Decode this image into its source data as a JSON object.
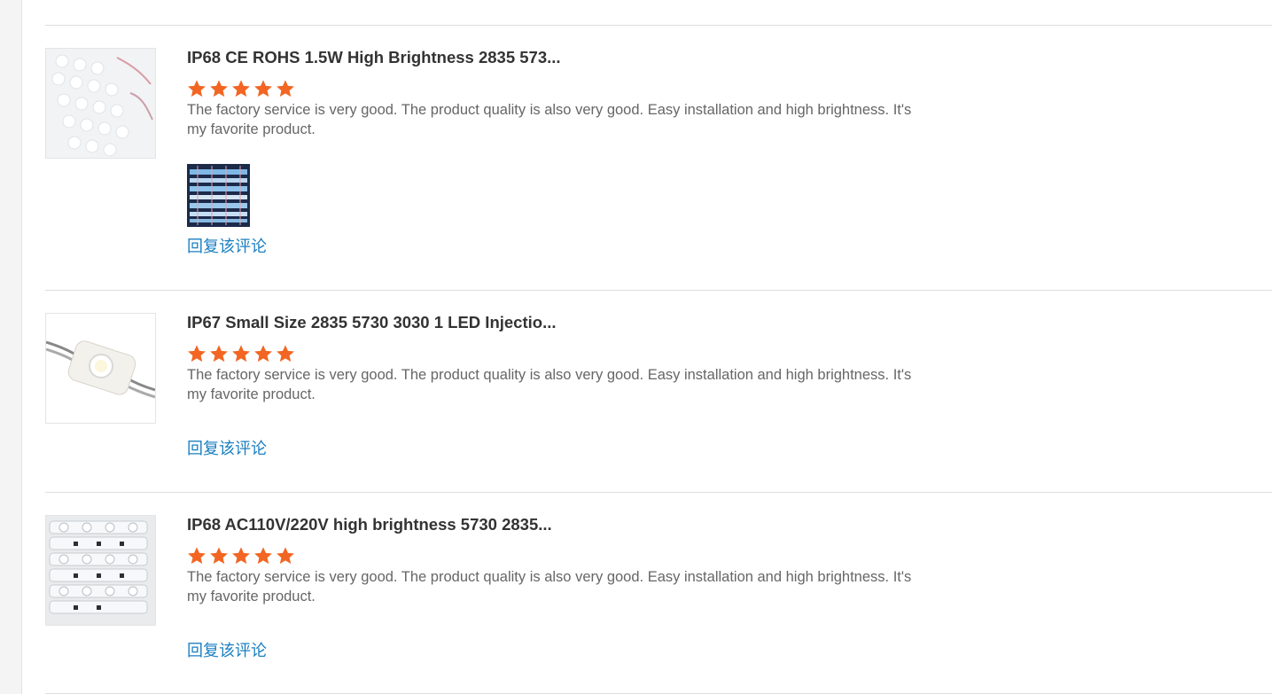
{
  "reviews": [
    {
      "title": "IP68 CE ROHS 1.5W High Brightness 2835 573...",
      "rating": 5,
      "text": "The factory service is very good. The product quality is also very good. Easy installation and high brightness. It's my favorite product.",
      "has_photo": true,
      "reply_label": "回复该评论"
    },
    {
      "title": "IP67 Small Size 2835 5730 3030 1 LED Injectio...",
      "rating": 5,
      "text": "The factory service is very good. The product quality is also very good. Easy installation and high brightness. It's my favorite product.",
      "has_photo": false,
      "reply_label": "回复该评论"
    },
    {
      "title": "IP68 AC110V/220V high brightness 5730 2835...",
      "rating": 5,
      "text": "The factory service is very good. The product quality is also very good. Easy installation and high brightness. It's my favorite product.",
      "has_photo": false,
      "reply_label": "回复该评论"
    }
  ],
  "colors": {
    "star": "#f26522",
    "reply_link": "#1a7fc1",
    "title": "#333333",
    "body_text": "#666666",
    "divider": "#dedede"
  },
  "icons": {
    "rating_star": "star-icon"
  }
}
